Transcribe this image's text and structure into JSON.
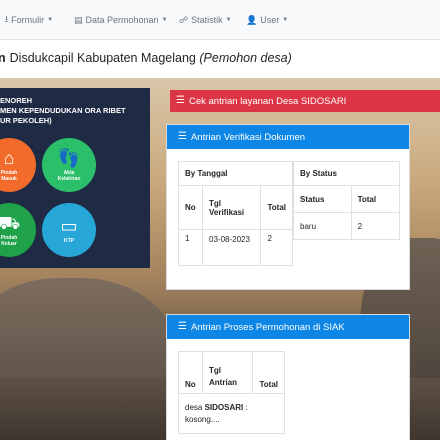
{
  "navbar": {
    "items": [
      {
        "icon": "download-icon",
        "label": "Formulir"
      },
      {
        "icon": "file-icon",
        "label": "Data Permohonan"
      },
      {
        "icon": "chart-icon",
        "label": "Statistik"
      },
      {
        "icon": "user-icon",
        "label": "User"
      }
    ]
  },
  "header": {
    "lead": "n",
    "title": "Disdukcapil Kabupaten Magelang",
    "subtitle": "(Pemohon desa)"
  },
  "poster": {
    "line1": "ENOREH",
    "line2": "MEN KEPENDUDUKAN ORA RIBET",
    "line3": "UR PEKOLEH)",
    "items": [
      {
        "caption_1": "Pindah",
        "caption_2": "Masuk",
        "color": "#f26b2a"
      },
      {
        "caption_1": "Akta",
        "caption_2": "Kelahiran",
        "color": "#2bbf6a"
      },
      {
        "caption_1": "Pindah",
        "caption_2": "Keluar",
        "color": "#1fa24a"
      },
      {
        "caption_1": "KTP",
        "caption_2": "",
        "color": "#27a6d8"
      }
    ]
  },
  "alert": {
    "label": "Cek antrian layanan Desa SIDOSARI",
    "color": "#dc3545"
  },
  "card1": {
    "header": "Antrian Verifikasi Dokumen",
    "by_date": {
      "title": "By Tanggal",
      "columns": [
        "No",
        "Tgl Verifikasi",
        "Total"
      ],
      "rows": [
        [
          "1",
          "03-08-2023",
          "2"
        ]
      ]
    },
    "by_status": {
      "title": "By Status",
      "columns": [
        "Status",
        "Total"
      ],
      "rows": [
        [
          "baru",
          "2"
        ]
      ]
    }
  },
  "card2": {
    "header": "Antrian Proses Permohonan di SIAK",
    "columns": [
      "No",
      "Tgl Antrian",
      "Total"
    ],
    "empty_prefix": "desa",
    "empty_desa": "SIDOSARI",
    "empty_suffix": ":",
    "empty_text": "kosong...."
  },
  "colors": {
    "accent": "#0d86e6",
    "danger": "#dc3545"
  }
}
